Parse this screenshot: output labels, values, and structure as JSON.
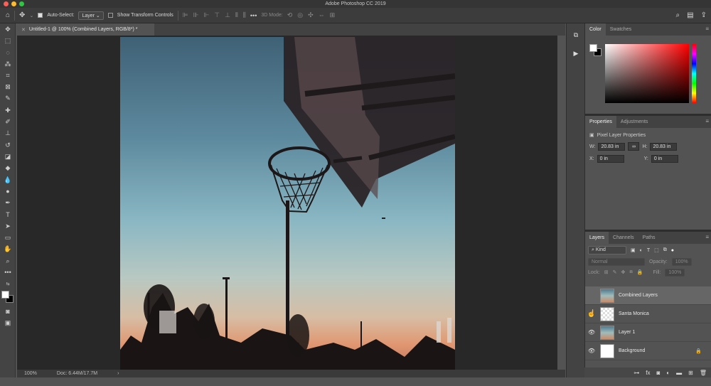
{
  "window": {
    "title": "Adobe Photoshop CC 2019"
  },
  "options_bar": {
    "auto_select_label": "Auto-Select:",
    "auto_select_value": "Layer",
    "show_transform_label": "Show Transform Controls",
    "mode_3d_label": "3D Mode:"
  },
  "document": {
    "tab_title": "Untitled-1 @ 100% (Combined Layers, RGB/8*) *",
    "zoom": "100%",
    "doc_size": "Doc: 6.44M/17.7M"
  },
  "color_panel": {
    "tabs": [
      "Color",
      "Swatches"
    ],
    "fg_color": "#ffffff",
    "bg_color": "#000000",
    "hue_color": "#ff0000"
  },
  "properties_panel": {
    "tabs": [
      "Properties",
      "Adjustments"
    ],
    "subtitle": "Pixel Layer Properties",
    "w_label": "W:",
    "w_value": "20.83 in",
    "h_label": "H:",
    "h_value": "20.83 in",
    "x_label": "X:",
    "x_value": "0 in",
    "y_label": "Y:",
    "y_value": "0 in"
  },
  "layers_panel": {
    "tabs": [
      "Layers",
      "Channels",
      "Paths"
    ],
    "filter_kind": "Kind",
    "blend_mode": "Normal",
    "opacity_label": "Opacity:",
    "opacity_value": "100%",
    "lock_label": "Lock:",
    "fill_label": "Fill:",
    "fill_value": "100%",
    "layers": [
      {
        "name": "Combined Layers",
        "visible": false,
        "selected": true
      },
      {
        "name": "Santa Monica",
        "visible": false,
        "selected": false
      },
      {
        "name": "Layer 1",
        "visible": true,
        "selected": false
      },
      {
        "name": "Background",
        "visible": true,
        "locked": true,
        "selected": false
      }
    ]
  }
}
